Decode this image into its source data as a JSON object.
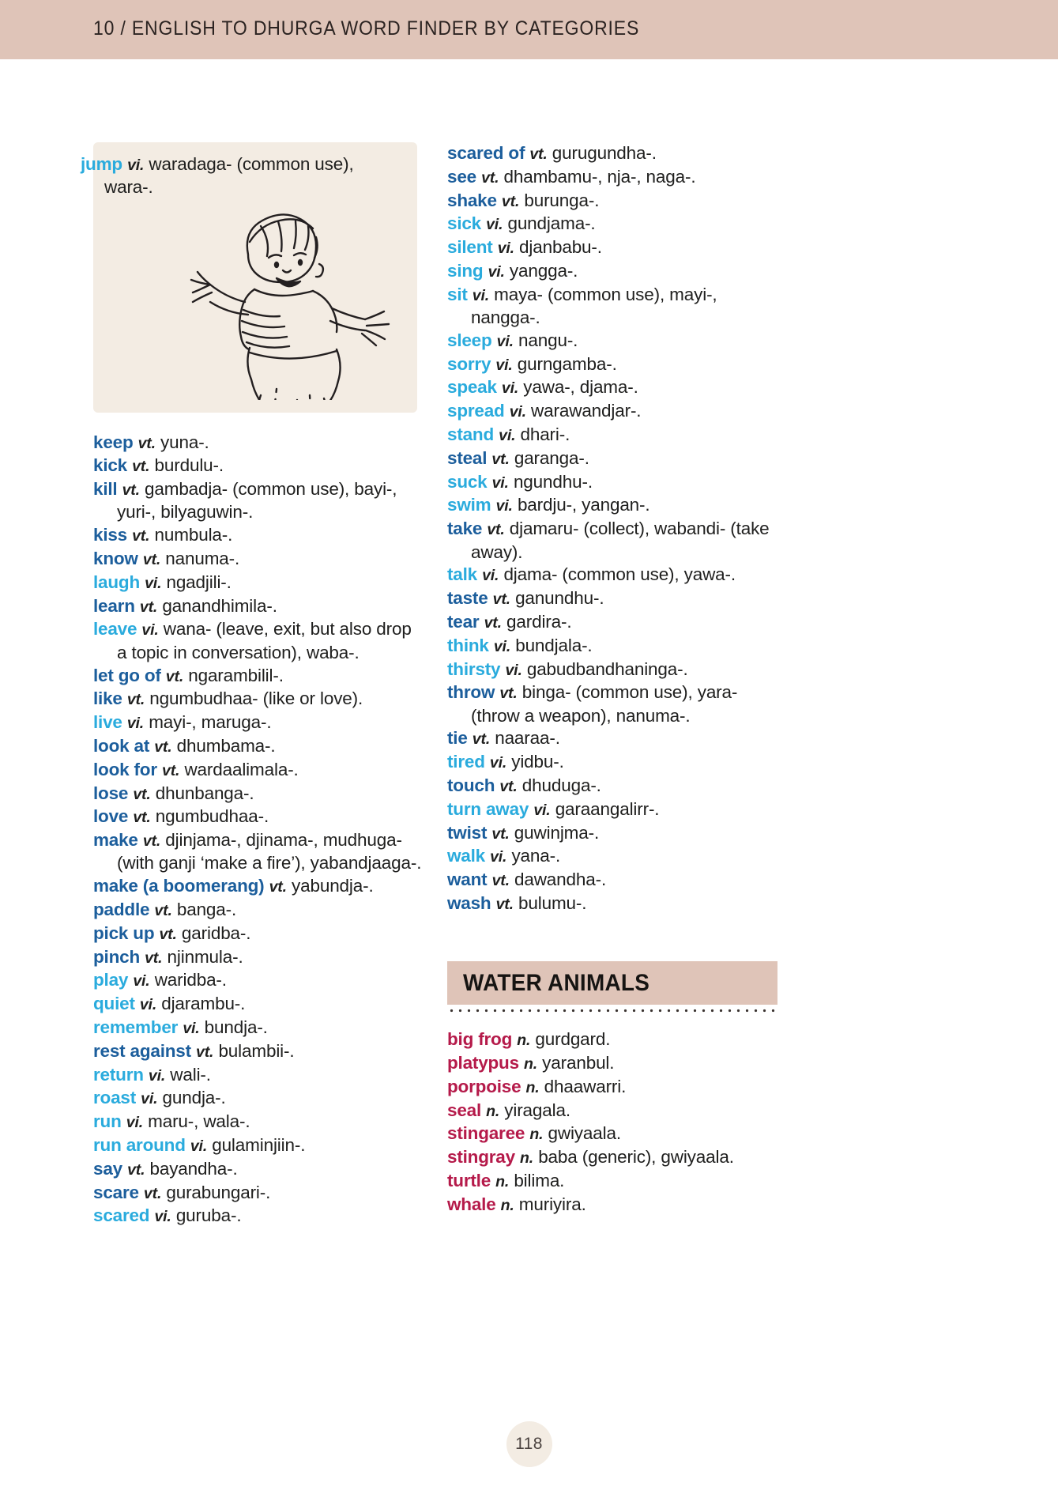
{
  "running_head": {
    "text": "10 / ENGLISH TO DHURGA WORD FINDER BY CATEGORIES"
  },
  "colors": {
    "header_band": "#dfc4b8",
    "headword_transitive": "#1c5e9c",
    "headword_intransitive": "#2aabdd",
    "headword_noun": "#b51a4a",
    "illustration_card": "#f3ece3",
    "category_banner": "#dfc4b8"
  },
  "illustration_card": {
    "entry": {
      "headword": "jump",
      "pos": "vi.",
      "gloss": "waradaga- (common use), wara-.",
      "type": "vi"
    },
    "figure_name": "jumping-child-illustration"
  },
  "left_column": {
    "entries": [
      {
        "headword": "keep",
        "pos": "vt.",
        "gloss": "yuna-.",
        "type": "vt"
      },
      {
        "headword": "kick",
        "pos": "vt.",
        "gloss": "burdulu-.",
        "type": "vt"
      },
      {
        "headword": "kill",
        "pos": "vt.",
        "gloss": "gambadja- (common use), bayi-, yuri-, bilyaguwin-.",
        "type": "vt"
      },
      {
        "headword": "kiss",
        "pos": "vt.",
        "gloss": "numbula-.",
        "type": "vt"
      },
      {
        "headword": "know",
        "pos": "vt.",
        "gloss": "nanuma-.",
        "type": "vt"
      },
      {
        "headword": "laugh",
        "pos": "vi.",
        "gloss": "ngadjili-.",
        "type": "vi"
      },
      {
        "headword": "learn",
        "pos": "vt.",
        "gloss": "ganandhimila-.",
        "type": "vt"
      },
      {
        "headword": "leave",
        "pos": "vi.",
        "gloss": "wana- (leave, exit, but also drop a topic in conversation), waba-.",
        "type": "vi"
      },
      {
        "headword": "let go of",
        "pos": "vt.",
        "gloss": "ngarambilil-.",
        "type": "vt"
      },
      {
        "headword": "like",
        "pos": "vt.",
        "gloss": "ngumbudhaa- (like or love).",
        "type": "vt"
      },
      {
        "headword": "live",
        "pos": "vi.",
        "gloss": "mayi-, maruga-.",
        "type": "vi"
      },
      {
        "headword": "look at",
        "pos": "vt.",
        "gloss": "dhumbama-.",
        "type": "vt"
      },
      {
        "headword": "look for",
        "pos": "vt.",
        "gloss": "wardaalimala-.",
        "type": "vt"
      },
      {
        "headword": "lose",
        "pos": "vt.",
        "gloss": "dhunbanga-.",
        "type": "vt"
      },
      {
        "headword": "love",
        "pos": "vt.",
        "gloss": "ngumbudhaa-.",
        "type": "vt"
      },
      {
        "headword": "make",
        "pos": "vt.",
        "gloss": "djinjama-, djinama-, mudhuga- (with ganji ‘make a fire’), yabandjaaga-.",
        "type": "vt"
      },
      {
        "headword": "make (a boomerang)",
        "pos": "vt.",
        "gloss": "yabundja-.",
        "type": "vt"
      },
      {
        "headword": "paddle",
        "pos": "vt.",
        "gloss": "banga-.",
        "type": "vt"
      },
      {
        "headword": "pick up",
        "pos": "vt.",
        "gloss": "garidba-.",
        "type": "vt"
      },
      {
        "headword": "pinch",
        "pos": "vt.",
        "gloss": "njinmula-.",
        "type": "vt"
      },
      {
        "headword": "play",
        "pos": "vi.",
        "gloss": "waridba-.",
        "type": "vi"
      },
      {
        "headword": "quiet",
        "pos": "vi.",
        "gloss": "djarambu-.",
        "type": "vi"
      },
      {
        "headword": "remember",
        "pos": "vi.",
        "gloss": "bundja-.",
        "type": "vi"
      },
      {
        "headword": "rest against",
        "pos": "vt.",
        "gloss": "bulambii-.",
        "type": "vt"
      },
      {
        "headword": "return",
        "pos": "vi.",
        "gloss": "wali-.",
        "type": "vi"
      },
      {
        "headword": "roast",
        "pos": "vi.",
        "gloss": "gundja-.",
        "type": "vi"
      },
      {
        "headword": "run",
        "pos": "vi.",
        "gloss": "maru-, wala-.",
        "type": "vi"
      },
      {
        "headword": "run around",
        "pos": "vi.",
        "gloss": "gulaminjiin-.",
        "type": "vi"
      },
      {
        "headword": "say",
        "pos": "vt.",
        "gloss": "bayandha-.",
        "type": "vt"
      },
      {
        "headword": "scare",
        "pos": "vt.",
        "gloss": "gurabungari-.",
        "type": "vt"
      },
      {
        "headword": "scared",
        "pos": "vi.",
        "gloss": "guruba-.",
        "type": "vi"
      }
    ]
  },
  "right_column": {
    "entries": [
      {
        "headword": "scared of",
        "pos": "vt.",
        "gloss": "gurugundha-.",
        "type": "vt"
      },
      {
        "headword": "see",
        "pos": "vt.",
        "gloss": "dhambamu-, nja-, naga-.",
        "type": "vt"
      },
      {
        "headword": "shake",
        "pos": "vt.",
        "gloss": "burunga-.",
        "type": "vt"
      },
      {
        "headword": "sick",
        "pos": "vi.",
        "gloss": "gundjama-.",
        "type": "vi"
      },
      {
        "headword": "silent",
        "pos": "vi.",
        "gloss": "djanbabu-.",
        "type": "vi"
      },
      {
        "headword": "sing",
        "pos": "vi.",
        "gloss": "yangga-.",
        "type": "vi"
      },
      {
        "headword": "sit",
        "pos": "vi.",
        "gloss": "maya- (common use), mayi-, nangga-.",
        "type": "vi"
      },
      {
        "headword": "sleep",
        "pos": "vi.",
        "gloss": "nangu-.",
        "type": "vi"
      },
      {
        "headword": "sorry",
        "pos": "vi.",
        "gloss": "gurngamba-.",
        "type": "vi"
      },
      {
        "headword": "speak",
        "pos": "vi.",
        "gloss": "yawa-, djama-.",
        "type": "vi"
      },
      {
        "headword": "spread",
        "pos": "vi.",
        "gloss": "warawandjar-.",
        "type": "vi"
      },
      {
        "headword": "stand",
        "pos": "vi.",
        "gloss": "dhari-.",
        "type": "vi"
      },
      {
        "headword": "steal",
        "pos": "vt.",
        "gloss": "garanga-.",
        "type": "vt"
      },
      {
        "headword": "suck",
        "pos": "vi.",
        "gloss": "ngundhu-.",
        "type": "vi"
      },
      {
        "headword": "swim",
        "pos": "vi.",
        "gloss": "bardju-, yangan-.",
        "type": "vi"
      },
      {
        "headword": "take",
        "pos": "vt.",
        "gloss": "djamaru- (collect), wabandi- (take away).",
        "type": "vt"
      },
      {
        "headword": "talk",
        "pos": "vi.",
        "gloss": "djama- (common use), yawa-.",
        "type": "vi"
      },
      {
        "headword": "taste",
        "pos": "vt.",
        "gloss": "ganundhu-.",
        "type": "vt"
      },
      {
        "headword": "tear",
        "pos": "vt.",
        "gloss": "gardira-.",
        "type": "vt"
      },
      {
        "headword": "think",
        "pos": "vi.",
        "gloss": "bundjala-.",
        "type": "vi"
      },
      {
        "headword": "thirsty",
        "pos": "vi.",
        "gloss": "gabudbandhaninga-.",
        "type": "vi"
      },
      {
        "headword": "throw",
        "pos": "vt.",
        "gloss": "binga- (common use), yara- (throw a weapon), nanuma-.",
        "type": "vt"
      },
      {
        "headword": "tie",
        "pos": "vt.",
        "gloss": "naaraa-.",
        "type": "vt"
      },
      {
        "headword": "tired",
        "pos": "vi.",
        "gloss": "yidbu-.",
        "type": "vi"
      },
      {
        "headword": "touch",
        "pos": "vt.",
        "gloss": "dhuduga-.",
        "type": "vt"
      },
      {
        "headword": "turn away",
        "pos": "vi.",
        "gloss": "garaangalirr-.",
        "type": "vi"
      },
      {
        "headword": "twist",
        "pos": "vt.",
        "gloss": "guwinjma-.",
        "type": "vt"
      },
      {
        "headword": "walk",
        "pos": "vi.",
        "gloss": "yana-.",
        "type": "vi"
      },
      {
        "headword": "want",
        "pos": "vt.",
        "gloss": "dawandha-.",
        "type": "vt"
      },
      {
        "headword": "wash",
        "pos": "vt.",
        "gloss": "bulumu-.",
        "type": "vt"
      }
    ],
    "category": {
      "title": "WATER ANIMALS",
      "entries": [
        {
          "headword": "big frog",
          "pos": "n.",
          "gloss": "gurdgard.",
          "type": "n"
        },
        {
          "headword": "platypus",
          "pos": "n.",
          "gloss": "yaranbul.",
          "type": "n"
        },
        {
          "headword": "porpoise",
          "pos": "n.",
          "gloss": "dhaawarri.",
          "type": "n"
        },
        {
          "headword": "seal",
          "pos": "n.",
          "gloss": "yiragala.",
          "type": "n"
        },
        {
          "headword": "stingaree",
          "pos": "n.",
          "gloss": "gwiyaala.",
          "type": "n"
        },
        {
          "headword": "stingray",
          "pos": "n.",
          "gloss": "baba (generic), gwiyaala.",
          "type": "n"
        },
        {
          "headword": "turtle",
          "pos": "n.",
          "gloss": "bilima.",
          "type": "n"
        },
        {
          "headword": "whale",
          "pos": "n.",
          "gloss": "muriyira.",
          "type": "n"
        }
      ]
    }
  },
  "folio": {
    "page_number": "118"
  }
}
